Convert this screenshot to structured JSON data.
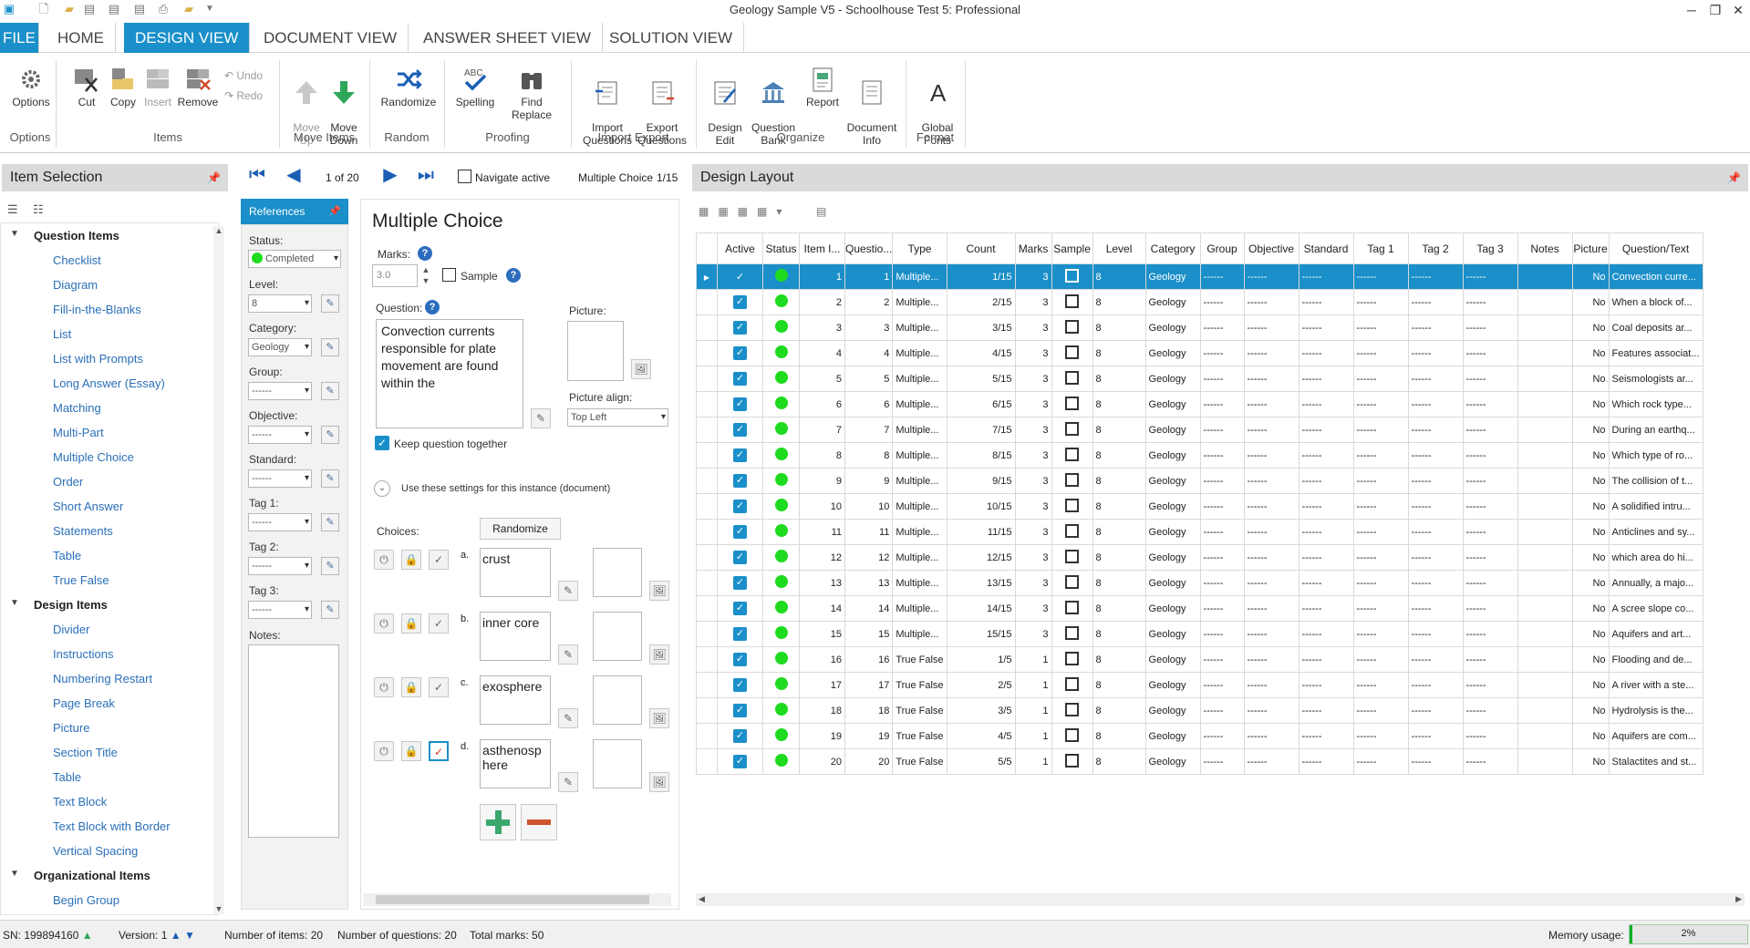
{
  "window": {
    "title": "Geology Sample V5 - Schoolhouse Test 5: Professional"
  },
  "tabs": [
    "FILE",
    "HOME",
    "DESIGN VIEW",
    "DOCUMENT VIEW",
    "ANSWER SHEET VIEW",
    "SOLUTION VIEW"
  ],
  "ribbon": {
    "options": "Options",
    "cut": "Cut",
    "copy": "Copy",
    "insert": "Insert",
    "remove": "Remove",
    "undo": "Undo",
    "redo": "Redo",
    "move_up": "Move\nUp",
    "move_down": "Move\nDown",
    "randomize": "Randomize",
    "spelling": "Spelling",
    "find_replace": "Find Replace",
    "import_questions": "Import\nQuestions",
    "export_questions": "Export\nQuestions",
    "design_edit": "Design\nEdit",
    "question_bank": "Question\nBank",
    "report": "Report",
    "document_info": "Document\nInfo",
    "global_fonts": "Global\nFonts",
    "groups": [
      "Options",
      "Items",
      "Move Items",
      "Random",
      "Proofing",
      "Import Export",
      "Organize",
      "Format"
    ]
  },
  "item_selection": {
    "title": "Item Selection",
    "sections": [
      {
        "label": "Question Items",
        "items": [
          "Checklist",
          "Diagram",
          "Fill-in-the-Blanks",
          "List",
          "List with Prompts",
          "Long Answer (Essay)",
          "Matching",
          "Multi-Part",
          "Multiple Choice",
          "Order",
          "Short Answer",
          "Statements",
          "Table",
          "True False"
        ]
      },
      {
        "label": "Design Items",
        "items": [
          "Divider",
          "Instructions",
          "Numbering Restart",
          "Page Break",
          "Picture",
          "Section Title",
          "Table",
          "Text Block",
          "Text Block with Border",
          "Vertical Spacing"
        ]
      },
      {
        "label": "Organizational Items",
        "items": [
          "Begin Group"
        ]
      }
    ]
  },
  "nav": {
    "position": "1 of 20",
    "navigate_active": "Navigate active",
    "item_type": "Multiple Choice",
    "count": "1/15"
  },
  "references": {
    "title": "References",
    "status_label": "Status:",
    "status_value": "Completed",
    "level_label": "Level:",
    "level_value": "8",
    "category_label": "Category:",
    "category_value": "Geology",
    "group_label": "Group:",
    "group_value": "------",
    "objective_label": "Objective:",
    "objective_value": "------",
    "standard_label": "Standard:",
    "standard_value": "------",
    "tag1_label": "Tag 1:",
    "tag1_value": "------",
    "tag2_label": "Tag 2:",
    "tag2_value": "------",
    "tag3_label": "Tag 3:",
    "tag3_value": "------",
    "notes_label": "Notes:"
  },
  "editor": {
    "heading": "Multiple Choice",
    "marks_label": "Marks:",
    "marks_value": "3.0",
    "sample_label": "Sample",
    "question_label": "Question:",
    "question_text": "Convection currents responsible for plate movement are found within the",
    "picture_label": "Picture:",
    "picture_align_label": "Picture align:",
    "picture_align_value": "Top Left",
    "keep_together": "Keep question together",
    "instance_settings": "Use these settings for this instance (document)",
    "choices_label": "Choices:",
    "randomize_btn": "Randomize",
    "choices": [
      {
        "letter": "a.",
        "text": "crust",
        "correct": false
      },
      {
        "letter": "b.",
        "text": "inner core",
        "correct": false
      },
      {
        "letter": "c.",
        "text": "exosphere",
        "correct": false
      },
      {
        "letter": "d.",
        "text": "asthenosp here",
        "correct": true
      }
    ]
  },
  "design_layout": {
    "title": "Design Layout",
    "columns": [
      "",
      "Active",
      "Status",
      "Item I...",
      "Questio...",
      "Type",
      "Count",
      "Marks",
      "Sample",
      "Level",
      "Category",
      "Group",
      "Objective",
      "Standard",
      "Tag 1",
      "Tag 2",
      "Tag 3",
      "Notes",
      "Picture",
      "Question/Text"
    ],
    "rows": [
      [
        "1",
        "1",
        "Multiple...",
        "1/15",
        "3",
        "8",
        "Geology",
        "No",
        "Convection curre..."
      ],
      [
        "2",
        "2",
        "Multiple...",
        "2/15",
        "3",
        "8",
        "Geology",
        "No",
        "When a block of..."
      ],
      [
        "3",
        "3",
        "Multiple...",
        "3/15",
        "3",
        "8",
        "Geology",
        "No",
        "Coal deposits ar..."
      ],
      [
        "4",
        "4",
        "Multiple...",
        "4/15",
        "3",
        "8",
        "Geology",
        "No",
        "Features associat..."
      ],
      [
        "5",
        "5",
        "Multiple...",
        "5/15",
        "3",
        "8",
        "Geology",
        "No",
        "Seismologists ar..."
      ],
      [
        "6",
        "6",
        "Multiple...",
        "6/15",
        "3",
        "8",
        "Geology",
        "No",
        "Which rock type..."
      ],
      [
        "7",
        "7",
        "Multiple...",
        "7/15",
        "3",
        "8",
        "Geology",
        "No",
        "During an earthq..."
      ],
      [
        "8",
        "8",
        "Multiple...",
        "8/15",
        "3",
        "8",
        "Geology",
        "No",
        "Which type of ro..."
      ],
      [
        "9",
        "9",
        "Multiple...",
        "9/15",
        "3",
        "8",
        "Geology",
        "No",
        "The collision of t..."
      ],
      [
        "10",
        "10",
        "Multiple...",
        "10/15",
        "3",
        "8",
        "Geology",
        "No",
        "A solidified intru..."
      ],
      [
        "11",
        "11",
        "Multiple...",
        "11/15",
        "3",
        "8",
        "Geology",
        "No",
        "Anticlines and sy..."
      ],
      [
        "12",
        "12",
        "Multiple...",
        "12/15",
        "3",
        "8",
        "Geology",
        "No",
        "which area do hi..."
      ],
      [
        "13",
        "13",
        "Multiple...",
        "13/15",
        "3",
        "8",
        "Geology",
        "No",
        "Annually, a majo..."
      ],
      [
        "14",
        "14",
        "Multiple...",
        "14/15",
        "3",
        "8",
        "Geology",
        "No",
        "A scree slope co..."
      ],
      [
        "15",
        "15",
        "Multiple...",
        "15/15",
        "3",
        "8",
        "Geology",
        "No",
        "Aquifers and art..."
      ],
      [
        "16",
        "16",
        "True False",
        "1/5",
        "1",
        "8",
        "Geology",
        "No",
        "Flooding and de..."
      ],
      [
        "17",
        "17",
        "True False",
        "2/5",
        "1",
        "8",
        "Geology",
        "No",
        "A river with a ste..."
      ],
      [
        "18",
        "18",
        "True False",
        "3/5",
        "1",
        "8",
        "Geology",
        "No",
        "Hydrolysis is the..."
      ],
      [
        "19",
        "19",
        "True False",
        "4/5",
        "1",
        "8",
        "Geology",
        "No",
        "Aquifers are com..."
      ],
      [
        "20",
        "20",
        "True False",
        "5/5",
        "1",
        "8",
        "Geology",
        "No",
        "Stalactites and st..."
      ]
    ],
    "placeholder": "------"
  },
  "status": {
    "sn": "SN: 199894160",
    "version": "Version: 1",
    "num_items": "Number of items: 20",
    "num_questions": "Number of questions: 20",
    "total_marks": "Total marks: 50",
    "memory_label": "Memory usage:",
    "memory_value": "2%"
  },
  "colors": {
    "accent": "#1a8fc9",
    "status_green": "#1fdb1f"
  }
}
